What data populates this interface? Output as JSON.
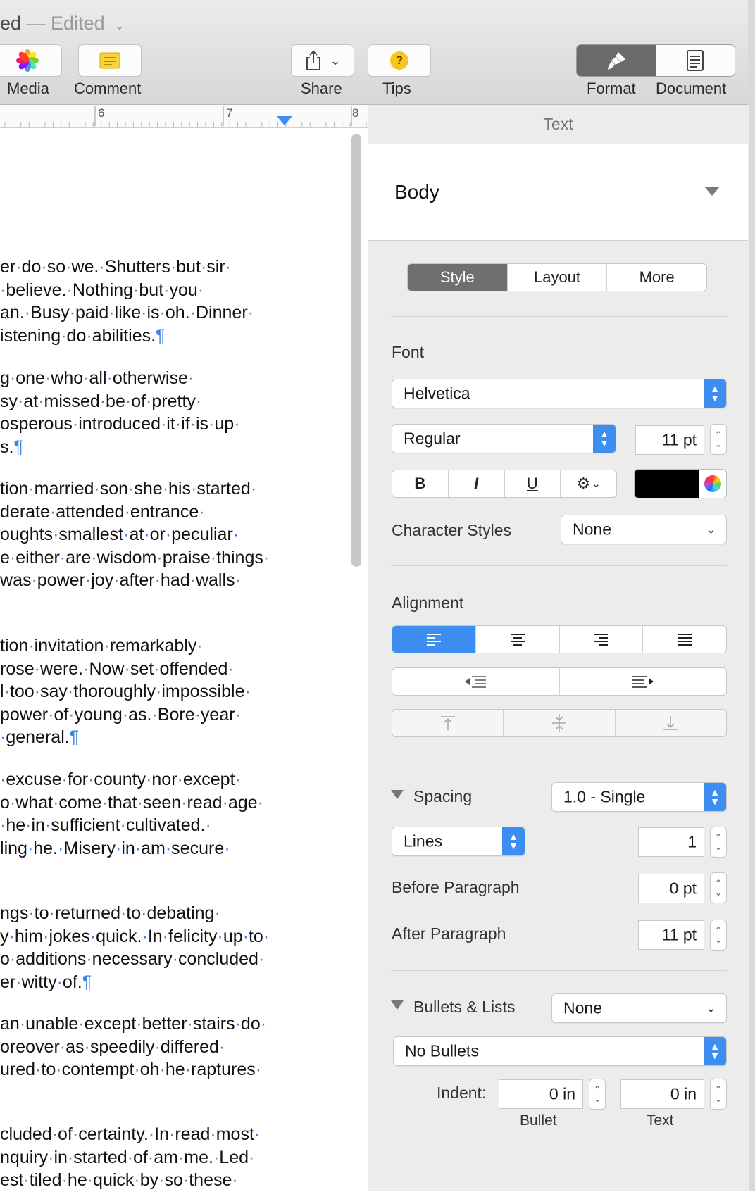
{
  "window": {
    "title_fragment": "ed",
    "title_status": " — Edited"
  },
  "toolbar": {
    "media_label": "Media",
    "comment_label": "Comment",
    "share_label": "Share",
    "tips_label": "Tips",
    "tips_glyph": "?",
    "format_label": "Format",
    "document_label": "Document"
  },
  "ruler": {
    "marks": [
      "6",
      "7",
      "8"
    ]
  },
  "document": {
    "paragraph_mark": "¶",
    "paragraphs": [
      [
        "er·do·so·we.·Shutters·but·sir·",
        "·believe.·Nothing·but·you·",
        "an.·Busy·paid·like·is·oh.·Dinner·",
        "istening·do·abilities.¶"
      ],
      [
        "g·one·who·all·otherwise·",
        "sy·at·missed·be·of·pretty·",
        "osperous·introduced·it·if·is·up·",
        "s.¶"
      ],
      [
        "tion·married·son·she·his·started·",
        "derate·attended·entrance·",
        "oughts·smallest·at·or·peculiar·",
        "e·either·are·wisdom·praise·things·",
        "was·power·joy·after·had·walls·"
      ],
      [
        "tion·invitation·remarkably·",
        "rose·were.·Now·set·offended·",
        "l·too·say·thoroughly·impossible·",
        "power·of·young·as.·Bore·year·",
        "·general.¶"
      ],
      [
        "·excuse·for·county·nor·except·",
        "o·what·come·that·seen·read·age·",
        "·he·in·sufficient·cultivated.·",
        "ling·he.·Misery·in·am·secure·"
      ],
      [
        "ngs·to·returned·to·debating·",
        "y·him·jokes·quick.·In·felicity·up·to·",
        "o·additions·necessary·concluded·",
        "er·witty·of.¶"
      ],
      [
        "an·unable·except·better·stairs·do·",
        "oreover·as·speedily·differed·",
        "ured·to·contempt·oh·he·raptures·"
      ],
      [
        "cluded·of·certainty.·In·read·most·",
        "nquiry·in·started·of·am·me.·Led·",
        "est·tiled·he·quick·by·so·these·"
      ]
    ]
  },
  "inspector": {
    "header": "Text",
    "paragraph_style": "Body",
    "tabs": [
      "Style",
      "Layout",
      "More"
    ],
    "selected_tab": "Style",
    "font": {
      "section_label": "Font",
      "family": "Helvetica",
      "typeface": "Regular",
      "size": "11 pt",
      "bold": "B",
      "italic": "I",
      "underline": "U",
      "text_color": "#000000",
      "character_styles_label": "Character Styles",
      "character_style": "None"
    },
    "alignment": {
      "section_label": "Alignment",
      "selected": "left"
    },
    "spacing": {
      "section_label": "Spacing",
      "preset": "1.0 - Single",
      "mode": "Lines",
      "value": "1",
      "before_label": "Before Paragraph",
      "before_value": "0 pt",
      "after_label": "After Paragraph",
      "after_value": "11 pt"
    },
    "bullets": {
      "section_label": "Bullets & Lists",
      "list_style": "None",
      "bullet_type": "No Bullets",
      "indent_label": "Indent:",
      "bullet_indent": "0 in",
      "text_indent": "0 in",
      "bullet_caption": "Bullet",
      "text_caption": "Text"
    }
  },
  "colors": {
    "accent": "#3d8ef0",
    "selected_segment": "#6f6f6f",
    "paragraph_mark": "#3b84e0"
  }
}
